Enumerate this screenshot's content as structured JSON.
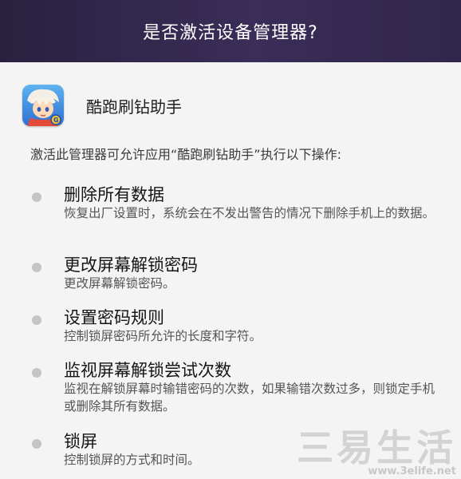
{
  "dialog": {
    "title": "是否激活设备管理器?"
  },
  "app": {
    "name": "酷跑刷钻助手",
    "icon": "game-character-icon"
  },
  "intro_text": "激活此管理器可允许应用“酷跑刷钻助手”执行以下操作:",
  "permissions": [
    {
      "title": "删除所有数据",
      "description": "恢复出厂设置时，系统会在不发出警告的情况下删除手机上的数据。"
    },
    {
      "title": "更改屏幕解锁密码",
      "description": "更改屏幕解锁密码。"
    },
    {
      "title": "设置密码规则",
      "description": "控制锁屏密码所允许的长度和字符。"
    },
    {
      "title": "监视屏幕解锁尝试次数",
      "description": "监视在解锁屏幕时输错密码的次数，如果输错次数过多，则锁定手机或删除其所有数据。"
    },
    {
      "title": "锁屏",
      "description": "控制锁屏的方式和时间。"
    }
  ],
  "watermark": {
    "logo": "三易生活",
    "url": "www.3elife.net"
  },
  "colors": {
    "titlebar": "#31264b",
    "background": "#f4f4f4",
    "bullet": "#c4c4c4"
  }
}
